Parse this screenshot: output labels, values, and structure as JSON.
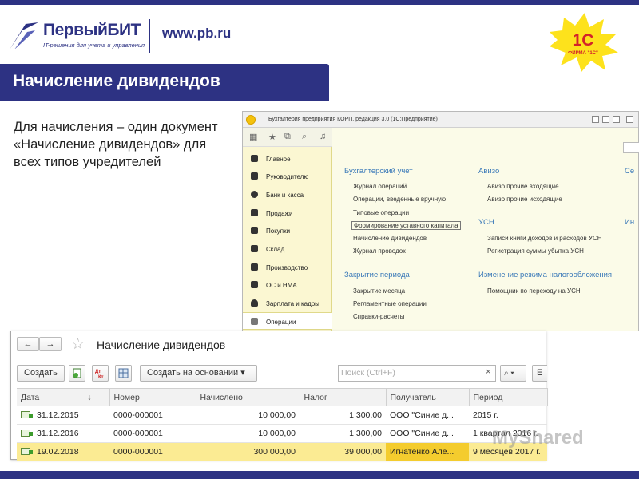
{
  "header": {
    "logo_text": "ПервыйБИТ",
    "logo_subtitle": "IT-решения для учета и управления",
    "website": "www.pb.ru",
    "badge_main": "1С",
    "badge_sub": "ФИРМА \"1С\""
  },
  "slide": {
    "title": "Начисление дивидендов",
    "description": "Для начисления – один документ «Начисление дивидендов» для всех типов учредителей"
  },
  "app_window": {
    "title": "Бухгалтерия предприятия КОРП, редакция 3.0 (1С:Предприятие)",
    "sidebar": [
      "Главное",
      "Руководителю",
      "Банк и касса",
      "Продажи",
      "Покупки",
      "Склад",
      "Производство",
      "ОС и НМА",
      "Зарплата и кадры",
      "Операции"
    ],
    "active_section": "Операции",
    "groups": [
      {
        "title": "Бухгалтерский учет",
        "items": [
          "Журнал операций",
          "Операции, введенные вручную",
          "Типовые операции",
          "Формирование уставного капитала",
          "Начисление дивидендов",
          "Журнал проводок"
        ]
      },
      {
        "title": "Закрытие периода",
        "items": [
          "Закрытие месяца",
          "Регламентные операции",
          "Справки-расчеты"
        ]
      },
      {
        "title": "Авизо",
        "items": [
          "Авизо прочие входящие",
          "Авизо прочие исходящие"
        ]
      },
      {
        "title": "УСН",
        "items": [
          "Записи книги доходов и расходов УСН",
          "Регистрация суммы убытка УСН"
        ]
      },
      {
        "title": "Изменение режима налогообложения",
        "items": [
          "Помощник по переходу на УСН"
        ]
      },
      {
        "title": "Се",
        "items": []
      },
      {
        "title": "Ин",
        "items": []
      }
    ]
  },
  "list_form": {
    "back_label": "←",
    "forward_label": "→",
    "title": "Начисление дивидендов",
    "create_label": "Создать",
    "create_based_label": "Создать на основании",
    "search_placeholder": "Поиск (Ctrl+F)",
    "clear_label": "×",
    "more_label": "Е",
    "columns": [
      "Дата",
      "Номер",
      "Начислено",
      "Налог",
      "Получатель",
      "Период"
    ],
    "sort_marker": "↓",
    "rows": [
      {
        "date": "31.12.2015",
        "number": "0000-000001",
        "accrued": "10 000,00",
        "tax": "1 300,00",
        "recipient": "ООО \"Синие д...",
        "period": "2015 г."
      },
      {
        "date": "31.12.2016",
        "number": "0000-000001",
        "accrued": "10 000,00",
        "tax": "1 300,00",
        "recipient": "ООО \"Синие д...",
        "period": "1 квартал 2016 г."
      },
      {
        "date": "19.02.2018",
        "number": "0000-000001",
        "accrued": "300 000,00",
        "tax": "39 000,00",
        "recipient": "Игнатенко Але...",
        "period": "9 месяцев 2017 г."
      }
    ]
  },
  "watermark": "MyShared",
  "colors": {
    "brand": "#2d3283",
    "menu_heading": "#3a79b8",
    "selection": "#fbeb93",
    "sidebar_bg": "#fbf7d2"
  }
}
